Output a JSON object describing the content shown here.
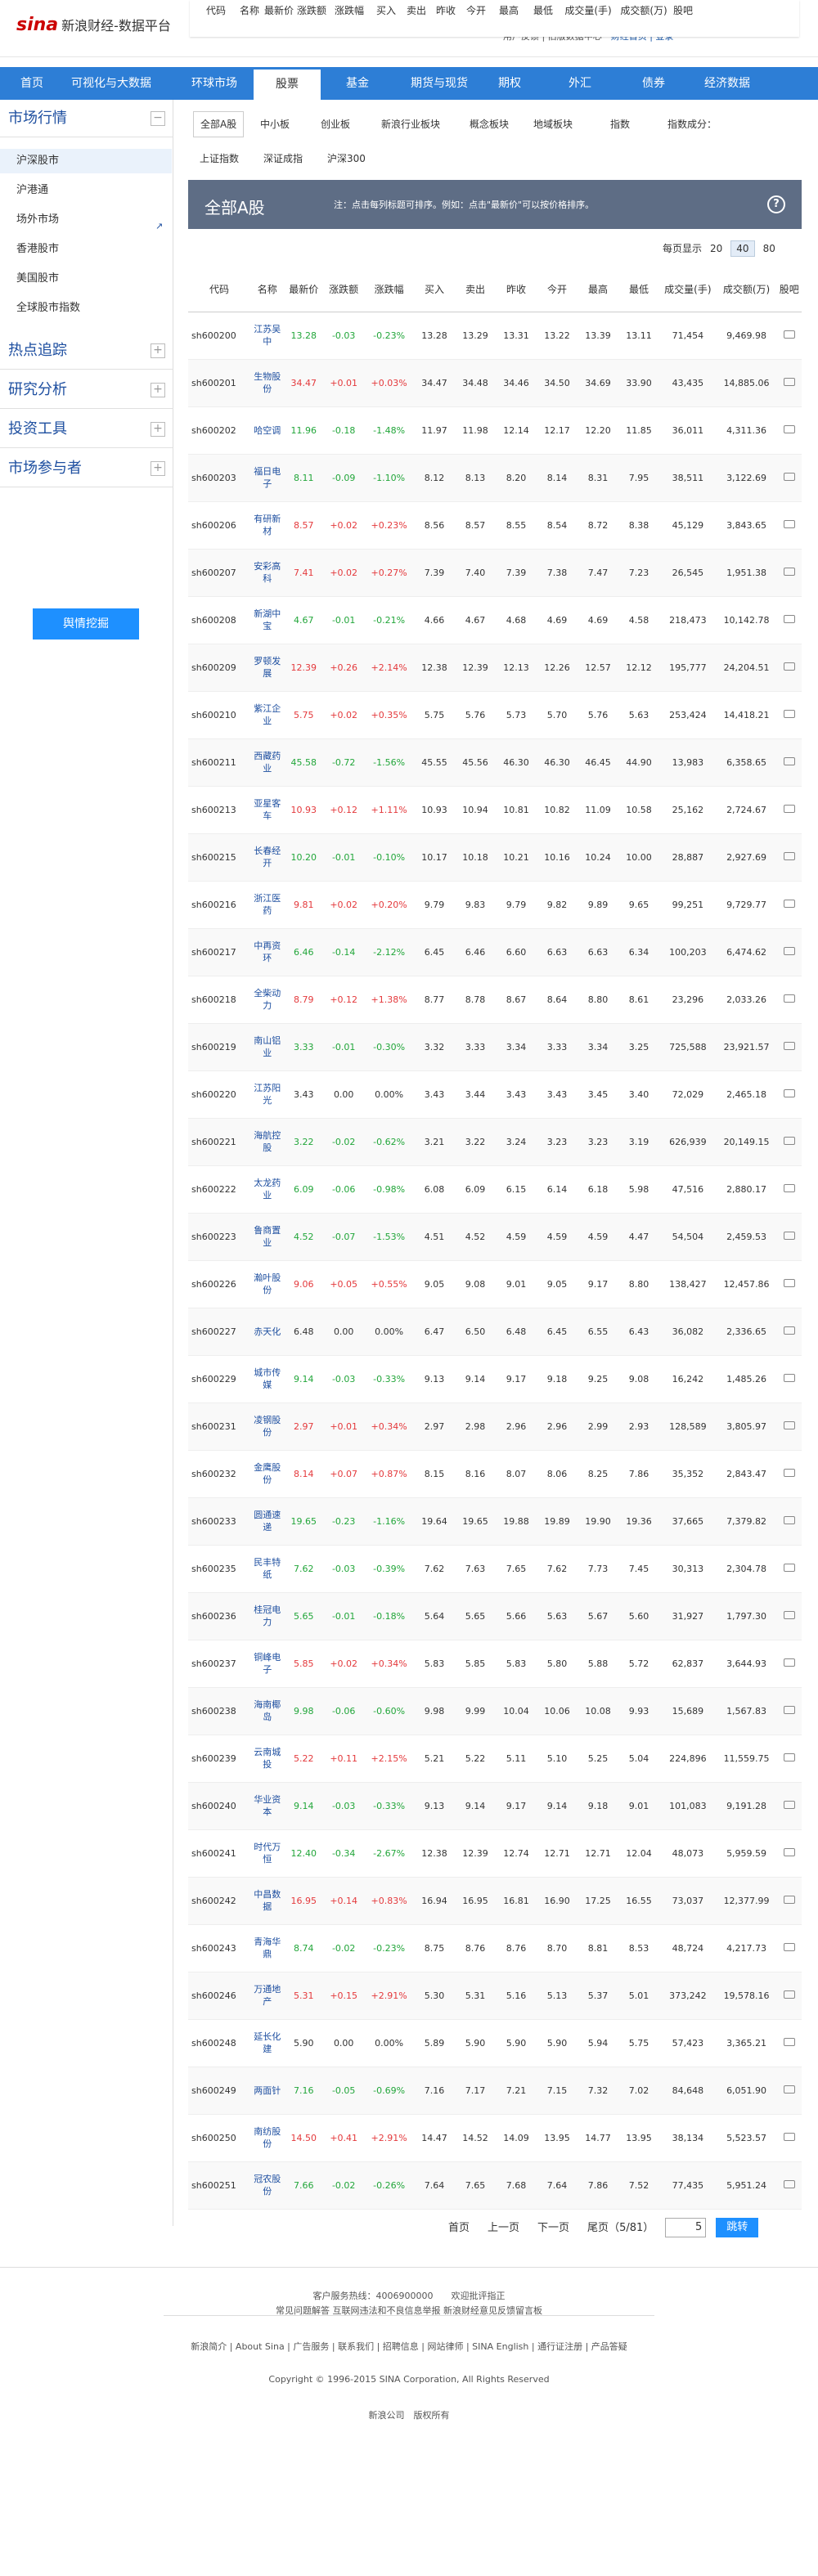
{
  "header": {
    "logo_text": "sina",
    "logo_sub": "新浪财经-数据平台",
    "links_text": "用户反馈 | 旧版数据中心",
    "links_extra": "财经首页 | 登录"
  },
  "sticky_header": {
    "columns": [
      "代码",
      "名称",
      "最新价",
      "涨跌额",
      "涨跌幅",
      "买入",
      "卖出",
      "昨收",
      "今开",
      "最高",
      "最低",
      "成交量(手)",
      "成交额(万)",
      "股吧"
    ]
  },
  "nav": [
    "首页",
    "可视化与大数据",
    "环球市场",
    "股票",
    "基金",
    "期货与现货",
    "期权",
    "外汇",
    "债券",
    "经济数据"
  ],
  "sidebar": {
    "market_title": "市场行情",
    "market_items": [
      "沪深股市",
      "沪港通",
      "场外市场",
      "香港股市",
      "美国股市",
      "全球股市指数"
    ],
    "sections": [
      "热点追踪",
      "研究分析",
      "投资工具",
      "市场参与者"
    ],
    "button": "舆情挖掘"
  },
  "tabs_row1": [
    "全部A股",
    "中小板",
    "创业板",
    "新浪行业板块",
    "概念板块",
    "地域板块",
    "指数",
    "指数成分："
  ],
  "tabs_row2": [
    "上证指数",
    "深证成指",
    "沪深300"
  ],
  "board": {
    "title": "全部A股",
    "tip": "注：点击每列标题可排序。例如：点击\"最新价\"可以按价格排序。",
    "help": "?"
  },
  "perpage": {
    "label": "每页显示",
    "options": [
      "20",
      "40",
      "80"
    ],
    "selected": "40"
  },
  "table": {
    "headers": [
      "代码",
      "名称",
      "最新价",
      "涨跌额",
      "涨跌幅",
      "买入",
      "卖出",
      "昨收",
      "今开",
      "最高",
      "最低",
      "成交量(手)",
      "成交额(万)",
      "股吧"
    ],
    "rows": [
      [
        "sh600200",
        "江苏吴中",
        "13.28",
        "-0.03",
        "-0.23%",
        "13.28",
        "13.29",
        "13.31",
        "13.22",
        "13.39",
        "13.11",
        "71,454",
        "9,469.98"
      ],
      [
        "sh600201",
        "生物股份",
        "34.47",
        "+0.01",
        "+0.03%",
        "34.47",
        "34.48",
        "34.46",
        "34.50",
        "34.69",
        "33.90",
        "43,435",
        "14,885.06"
      ],
      [
        "sh600202",
        "哈空调",
        "11.96",
        "-0.18",
        "-1.48%",
        "11.97",
        "11.98",
        "12.14",
        "12.17",
        "12.20",
        "11.85",
        "36,011",
        "4,311.36"
      ],
      [
        "sh600203",
        "福日电子",
        "8.11",
        "-0.09",
        "-1.10%",
        "8.12",
        "8.13",
        "8.20",
        "8.14",
        "8.31",
        "7.95",
        "38,511",
        "3,122.69"
      ],
      [
        "sh600206",
        "有研新材",
        "8.57",
        "+0.02",
        "+0.23%",
        "8.56",
        "8.57",
        "8.55",
        "8.54",
        "8.72",
        "8.38",
        "45,129",
        "3,843.65"
      ],
      [
        "sh600207",
        "安彩高科",
        "7.41",
        "+0.02",
        "+0.27%",
        "7.39",
        "7.40",
        "7.39",
        "7.38",
        "7.47",
        "7.23",
        "26,545",
        "1,951.38"
      ],
      [
        "sh600208",
        "新湖中宝",
        "4.67",
        "-0.01",
        "-0.21%",
        "4.66",
        "4.67",
        "4.68",
        "4.69",
        "4.69",
        "4.58",
        "218,473",
        "10,142.78"
      ],
      [
        "sh600209",
        "罗顿发展",
        "12.39",
        "+0.26",
        "+2.14%",
        "12.38",
        "12.39",
        "12.13",
        "12.26",
        "12.57",
        "12.12",
        "195,777",
        "24,204.51"
      ],
      [
        "sh600210",
        "紫江企业",
        "5.75",
        "+0.02",
        "+0.35%",
        "5.75",
        "5.76",
        "5.73",
        "5.70",
        "5.76",
        "5.63",
        "253,424",
        "14,418.21"
      ],
      [
        "sh600211",
        "西藏药业",
        "45.58",
        "-0.72",
        "-1.56%",
        "45.55",
        "45.56",
        "46.30",
        "46.30",
        "46.45",
        "44.90",
        "13,983",
        "6,358.65"
      ],
      [
        "sh600213",
        "亚星客车",
        "10.93",
        "+0.12",
        "+1.11%",
        "10.93",
        "10.94",
        "10.81",
        "10.82",
        "11.09",
        "10.58",
        "25,162",
        "2,724.67"
      ],
      [
        "sh600215",
        "长春经开",
        "10.20",
        "-0.01",
        "-0.10%",
        "10.17",
        "10.18",
        "10.21",
        "10.16",
        "10.24",
        "10.00",
        "28,887",
        "2,927.69"
      ],
      [
        "sh600216",
        "浙江医药",
        "9.81",
        "+0.02",
        "+0.20%",
        "9.79",
        "9.83",
        "9.79",
        "9.82",
        "9.89",
        "9.65",
        "99,251",
        "9,729.77"
      ],
      [
        "sh600217",
        "中再资环",
        "6.46",
        "-0.14",
        "-2.12%",
        "6.45",
        "6.46",
        "6.60",
        "6.63",
        "6.63",
        "6.34",
        "100,203",
        "6,474.62"
      ],
      [
        "sh600218",
        "全柴动力",
        "8.79",
        "+0.12",
        "+1.38%",
        "8.77",
        "8.78",
        "8.67",
        "8.64",
        "8.80",
        "8.61",
        "23,296",
        "2,033.26"
      ],
      [
        "sh600219",
        "南山铝业",
        "3.33",
        "-0.01",
        "-0.30%",
        "3.32",
        "3.33",
        "3.34",
        "3.33",
        "3.34",
        "3.25",
        "725,588",
        "23,921.57"
      ],
      [
        "sh600220",
        "江苏阳光",
        "3.43",
        "0.00",
        "0.00%",
        "3.43",
        "3.44",
        "3.43",
        "3.43",
        "3.45",
        "3.40",
        "72,029",
        "2,465.18"
      ],
      [
        "sh600221",
        "海航控股",
        "3.22",
        "-0.02",
        "-0.62%",
        "3.21",
        "3.22",
        "3.24",
        "3.23",
        "3.23",
        "3.19",
        "626,939",
        "20,149.15"
      ],
      [
        "sh600222",
        "太龙药业",
        "6.09",
        "-0.06",
        "-0.98%",
        "6.08",
        "6.09",
        "6.15",
        "6.14",
        "6.18",
        "5.98",
        "47,516",
        "2,880.17"
      ],
      [
        "sh600223",
        "鲁商置业",
        "4.52",
        "-0.07",
        "-1.53%",
        "4.51",
        "4.52",
        "4.59",
        "4.59",
        "4.59",
        "4.47",
        "54,504",
        "2,459.53"
      ],
      [
        "sh600226",
        "瀚叶股份",
        "9.06",
        "+0.05",
        "+0.55%",
        "9.05",
        "9.08",
        "9.01",
        "9.05",
        "9.17",
        "8.80",
        "138,427",
        "12,457.86"
      ],
      [
        "sh600227",
        "赤天化",
        "6.48",
        "0.00",
        "0.00%",
        "6.47",
        "6.50",
        "6.48",
        "6.45",
        "6.55",
        "6.43",
        "36,082",
        "2,336.65"
      ],
      [
        "sh600229",
        "城市传媒",
        "9.14",
        "-0.03",
        "-0.33%",
        "9.13",
        "9.14",
        "9.17",
        "9.18",
        "9.25",
        "9.08",
        "16,242",
        "1,485.26"
      ],
      [
        "sh600231",
        "凌钢股份",
        "2.97",
        "+0.01",
        "+0.34%",
        "2.97",
        "2.98",
        "2.96",
        "2.96",
        "2.99",
        "2.93",
        "128,589",
        "3,805.97"
      ],
      [
        "sh600232",
        "金鹰股份",
        "8.14",
        "+0.07",
        "+0.87%",
        "8.15",
        "8.16",
        "8.07",
        "8.06",
        "8.25",
        "7.86",
        "35,352",
        "2,843.47"
      ],
      [
        "sh600233",
        "圆通速递",
        "19.65",
        "-0.23",
        "-1.16%",
        "19.64",
        "19.65",
        "19.88",
        "19.89",
        "19.90",
        "19.36",
        "37,665",
        "7,379.82"
      ],
      [
        "sh600235",
        "民丰特纸",
        "7.62",
        "-0.03",
        "-0.39%",
        "7.62",
        "7.63",
        "7.65",
        "7.62",
        "7.73",
        "7.45",
        "30,313",
        "2,304.78"
      ],
      [
        "sh600236",
        "桂冠电力",
        "5.65",
        "-0.01",
        "-0.18%",
        "5.64",
        "5.65",
        "5.66",
        "5.63",
        "5.67",
        "5.60",
        "31,927",
        "1,797.30"
      ],
      [
        "sh600237",
        "铜峰电子",
        "5.85",
        "+0.02",
        "+0.34%",
        "5.83",
        "5.85",
        "5.83",
        "5.80",
        "5.88",
        "5.72",
        "62,837",
        "3,644.93"
      ],
      [
        "sh600238",
        "海南椰岛",
        "9.98",
        "-0.06",
        "-0.60%",
        "9.98",
        "9.99",
        "10.04",
        "10.06",
        "10.08",
        "9.93",
        "15,689",
        "1,567.83"
      ],
      [
        "sh600239",
        "云南城投",
        "5.22",
        "+0.11",
        "+2.15%",
        "5.21",
        "5.22",
        "5.11",
        "5.10",
        "5.25",
        "5.04",
        "224,896",
        "11,559.75"
      ],
      [
        "sh600240",
        "华业资本",
        "9.14",
        "-0.03",
        "-0.33%",
        "9.13",
        "9.14",
        "9.17",
        "9.14",
        "9.18",
        "9.01",
        "101,083",
        "9,191.28"
      ],
      [
        "sh600241",
        "时代万恒",
        "12.40",
        "-0.34",
        "-2.67%",
        "12.38",
        "12.39",
        "12.74",
        "12.71",
        "12.71",
        "12.04",
        "48,073",
        "5,959.59"
      ],
      [
        "sh600242",
        "中昌数据",
        "16.95",
        "+0.14",
        "+0.83%",
        "16.94",
        "16.95",
        "16.81",
        "16.90",
        "17.25",
        "16.55",
        "73,037",
        "12,377.99"
      ],
      [
        "sh600243",
        "青海华鼎",
        "8.74",
        "-0.02",
        "-0.23%",
        "8.75",
        "8.76",
        "8.76",
        "8.70",
        "8.81",
        "8.53",
        "48,724",
        "4,217.73"
      ],
      [
        "sh600246",
        "万通地产",
        "5.31",
        "+0.15",
        "+2.91%",
        "5.30",
        "5.31",
        "5.16",
        "5.13",
        "5.37",
        "5.01",
        "373,242",
        "19,578.16"
      ],
      [
        "sh600248",
        "延长化建",
        "5.90",
        "0.00",
        "0.00%",
        "5.89",
        "5.90",
        "5.90",
        "5.90",
        "5.94",
        "5.75",
        "57,423",
        "3,365.21"
      ],
      [
        "sh600249",
        "两面针",
        "7.16",
        "-0.05",
        "-0.69%",
        "7.16",
        "7.17",
        "7.21",
        "7.15",
        "7.32",
        "7.02",
        "84,648",
        "6,051.90"
      ],
      [
        "sh600250",
        "南纺股份",
        "14.50",
        "+0.41",
        "+2.91%",
        "14.47",
        "14.52",
        "14.09",
        "13.95",
        "14.77",
        "13.95",
        "38,134",
        "5,523.57"
      ],
      [
        "sh600251",
        "冠农股份",
        "7.66",
        "-0.02",
        "-0.26%",
        "7.64",
        "7.65",
        "7.68",
        "7.64",
        "7.86",
        "7.52",
        "77,435",
        "5,951.24"
      ]
    ]
  },
  "pager": {
    "first": "首页",
    "prev": "上一页",
    "next": "下一页",
    "last": "尾页",
    "info": "（5/81）",
    "input_value": "5",
    "go": "跳转"
  },
  "footer": {
    "line1": "客户服务热线：4006900000　　欢迎批评指正",
    "line2": "常见问题解答 互联网违法和不良信息举报 新浪财经意见反馈留言板",
    "line3": "新浪简介 | About Sina | 广告服务 | 联系我们 | 招聘信息 | 网站律师 | SINA English | 通行证注册 | 产品答疑",
    "line4": "Copyright © 1996-2015 SINA Corporation, All Rights Reserved",
    "line5": "新浪公司　版权所有"
  },
  "colors": {
    "nav_blue": "#2d7ed6",
    "up_red": "#e4393c",
    "down_green": "#22a63a",
    "board_header": "#5e6d85",
    "button_blue": "#1e90ff"
  }
}
